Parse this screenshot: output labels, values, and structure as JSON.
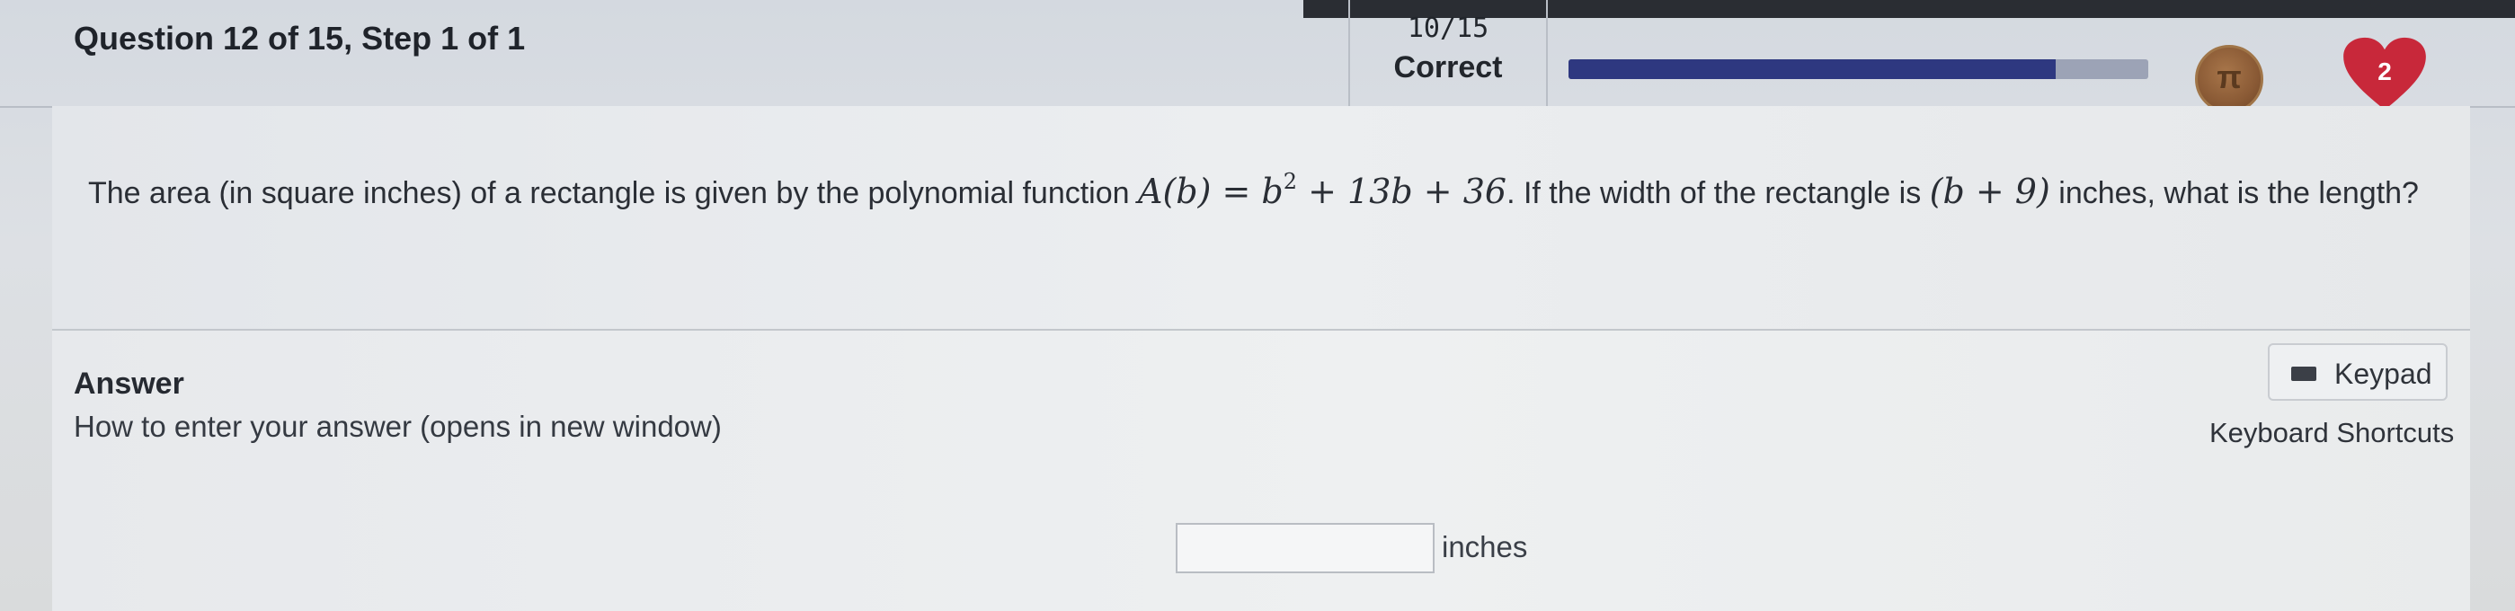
{
  "header": {
    "question_title": "Question 12 of 15, Step 1 of 1",
    "score": "10/15",
    "status": "Correct",
    "progress_fraction": 0.84,
    "medal_glyph": "π",
    "hearts_count": "2"
  },
  "question": {
    "text_before": "The area (in square inches) of a rectangle is given by the polynomial function ",
    "function_lhs": "A(b) = b",
    "function_exp": "2",
    "function_rhs": " + 13b + 36",
    "text_middle": ". If the width of the rectangle is ",
    "width_expr": "(b + 9)",
    "text_after": " inches, what is the length?"
  },
  "answer": {
    "label": "Answer",
    "howto_link": "How to enter your answer (opens in new window)",
    "keypad_label": "Keypad",
    "shortcuts_label": "Keyboard Shortcuts",
    "input_value": "",
    "unit": "inches"
  },
  "colors": {
    "progress_fill": "#2e3880",
    "progress_track": "#9ca3b6",
    "heart": "#c8283a",
    "medal": "#8a5a35"
  }
}
